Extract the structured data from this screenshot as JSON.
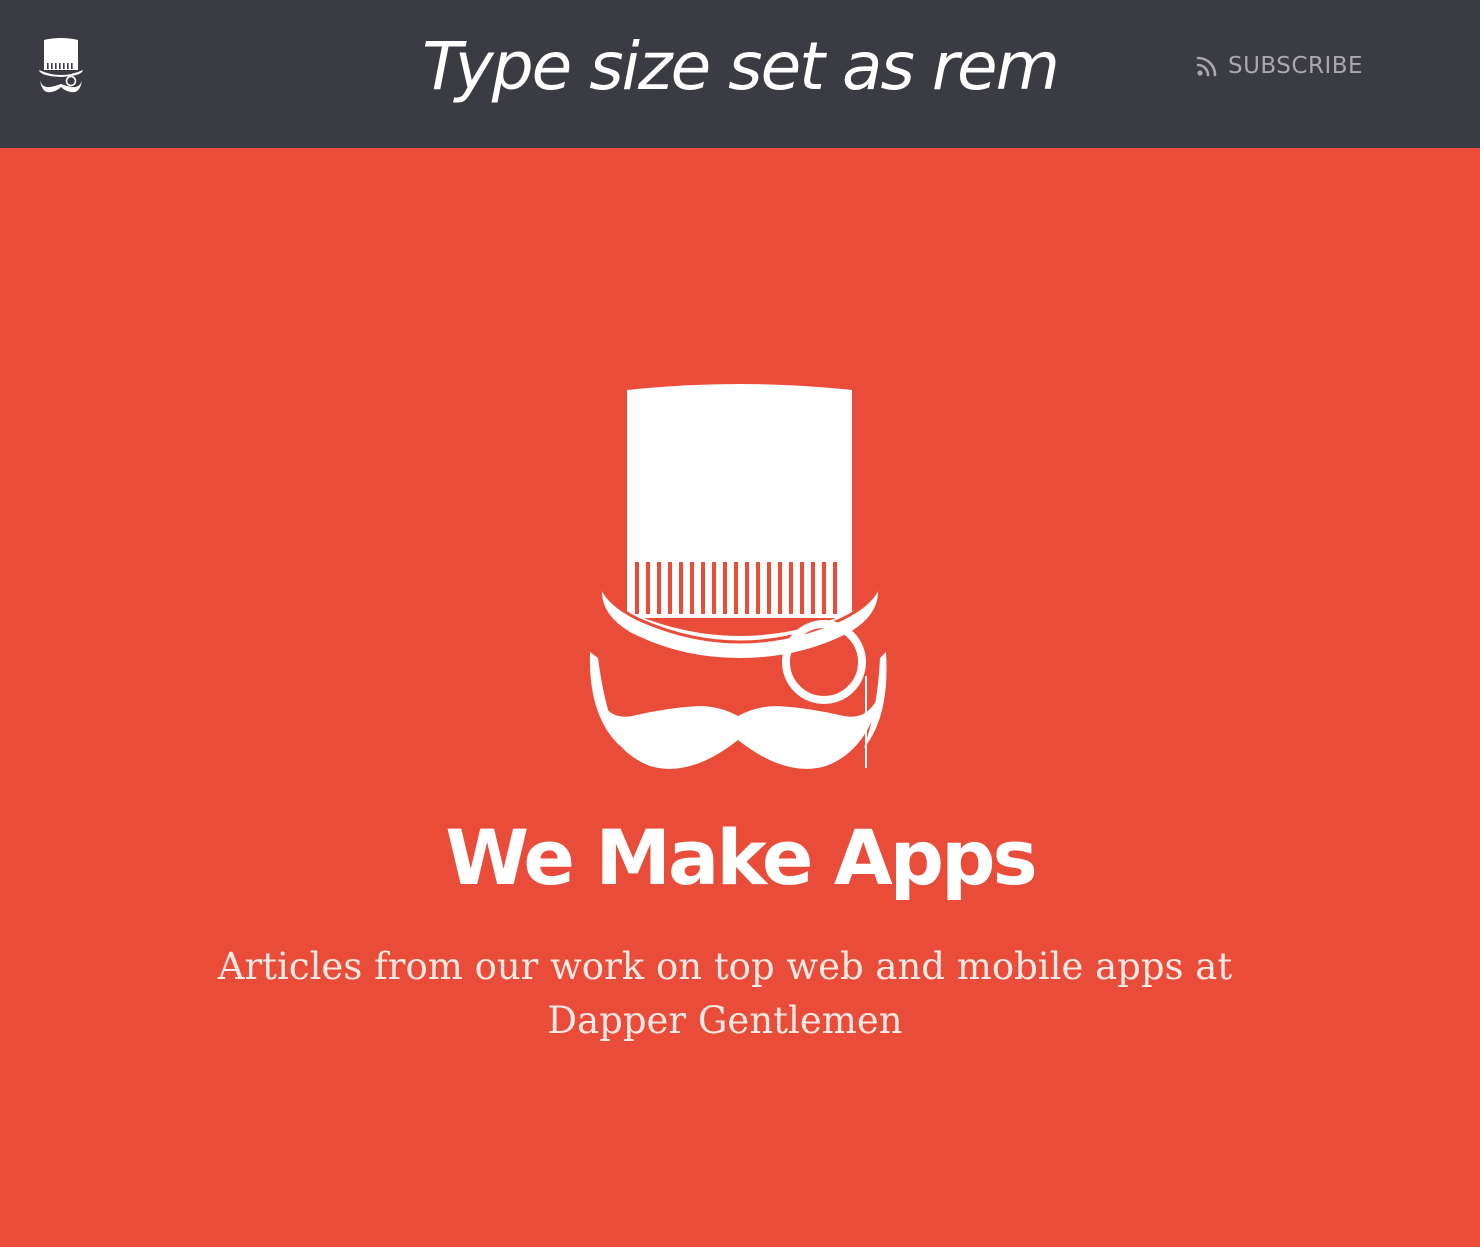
{
  "header": {
    "title": "Type size set as rem",
    "subscribe_label": "SUBSCRIBE",
    "logo_icon": "top-hat-mustache-icon",
    "subscribe_icon": "rss-icon"
  },
  "hero": {
    "heading": "We Make Apps",
    "description": "Articles from our work on top web and mobile apps at Dapper Gentlemen",
    "logo_icon": "top-hat-monocle-mustache-logo"
  },
  "colors": {
    "header_bg": "#3b3b44",
    "hero_bg": "#e94c38",
    "text": "#ffffff",
    "muted": "#a8a8ae"
  }
}
